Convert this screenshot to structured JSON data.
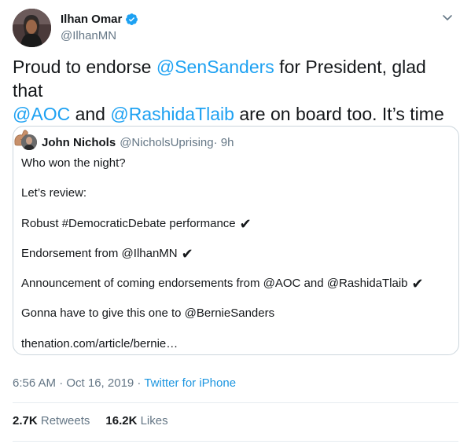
{
  "author": {
    "display_name": "Ilhan Omar",
    "handle": "@IlhanMN"
  },
  "tweet": {
    "text_1": "Proud to endorse ",
    "mention_1": "@SenSanders",
    "text_2": " for President, glad that ",
    "mention_2": "@AOC",
    "text_3": " and ",
    "mention_3": "@RashidaTlaib",
    "text_4": " are on board too. It’s time "
  },
  "quoted": {
    "display_name": "John Nichols",
    "handle": "@NicholsUprising",
    "time": " · 9h",
    "lines": [
      "Who won the night?",
      "Let’s review:",
      "Robust #DemocraticDebate performance",
      "Endorsement from @IlhanMN",
      "Announcement of coming endorsements from @AOC and @RashidaTlaib",
      "Gonna have to give this one to @BernieSanders",
      "thenation.com/article/bernie…"
    ],
    "check": "✔"
  },
  "meta": {
    "timestamp": "6:56 AM · Oct 16, 2019",
    "separator": " · ",
    "source": "Twitter for iPhone"
  },
  "stats": {
    "retweets_count": "2.7K",
    "retweets_label": "Retweets",
    "likes_count": "16.2K",
    "likes_label": "Likes"
  },
  "colors": {
    "accent": "#1da1f2",
    "text": "#14171a",
    "muted": "#657786",
    "border": "#ccd6dd"
  }
}
